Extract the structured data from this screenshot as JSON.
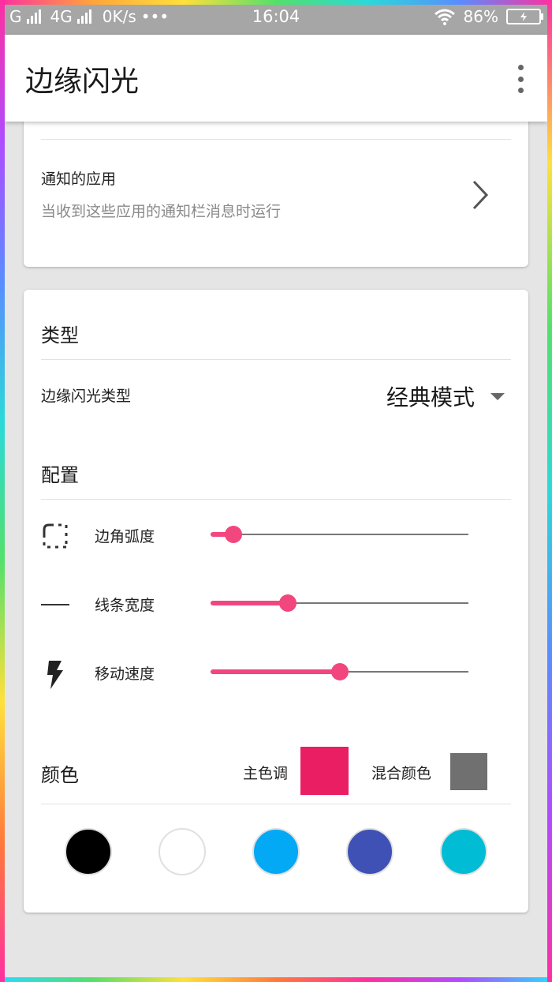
{
  "status_bar": {
    "carrier1": "G",
    "carrier2": "4G",
    "net_speed": "0K/s",
    "dots": "•••",
    "time": "16:04",
    "battery": "86%"
  },
  "app_bar": {
    "title": "边缘闪光",
    "more_icon": "more-vert-icon"
  },
  "card1": {
    "app_notify_title": "通知的应用",
    "app_notify_subtitle": "当收到这些应用的通知栏消息时运行"
  },
  "type_section": {
    "heading": "类型",
    "flash_type_label": "边缘闪光类型",
    "flash_type_value": "经典模式"
  },
  "config_section": {
    "heading": "配置",
    "sliders": [
      {
        "label": "边角弧度",
        "icon": "rounded-corner-icon",
        "value": 0.09
      },
      {
        "label": "线条宽度",
        "icon": "line-width-icon",
        "value": 0.3
      },
      {
        "label": "移动速度",
        "icon": "flash-icon",
        "value": 0.5
      }
    ]
  },
  "color_section": {
    "heading": "颜色",
    "primary_label": "主色调",
    "primary_color": "#e91e63",
    "mix_label": "混合颜色",
    "mix_color": "#707070",
    "palette": [
      "#000000",
      "#ffffff",
      "#03a9f4",
      "#3f51b5",
      "#00bcd4"
    ]
  },
  "colors": {
    "accent": "#f2467f",
    "status_bar": "#a6a6a6"
  }
}
